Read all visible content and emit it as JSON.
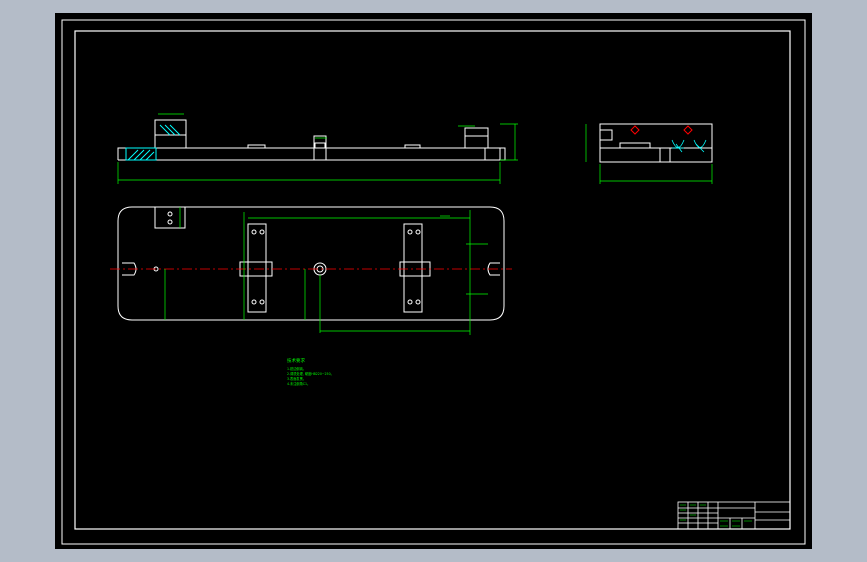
{
  "app": {
    "background_color": "#b4bcc8",
    "canvas_color": "#000000",
    "colors": {
      "outline": "#ffffff",
      "dimension": "#00ff00",
      "centerline": "#ff0000",
      "hatch": "#00ffff"
    }
  },
  "notes": {
    "title": "技术要求",
    "lines": [
      "1.锐边倒钝。",
      "2.调质处理, 硬度HB220~250。",
      "3.表面发黑。",
      "4.未注倒角C1。"
    ]
  },
  "title_block": {
    "visible": true
  }
}
